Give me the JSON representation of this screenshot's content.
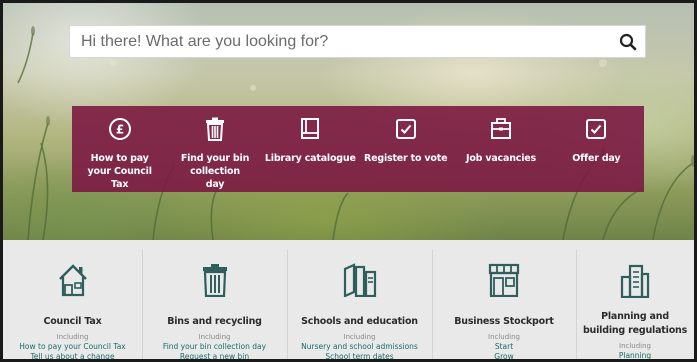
{
  "search": {
    "placeholder": "Hi there! What are you looking for?",
    "button_icon": "search-icon"
  },
  "quick_links": [
    {
      "label": "How to pay your Council Tax",
      "icon": "pound-coin-icon"
    },
    {
      "label": "Find your bin collection day",
      "icon": "bin-icon"
    },
    {
      "label": "Library catalogue",
      "icon": "book-icon"
    },
    {
      "label": "Register to vote",
      "icon": "checkbox-icon"
    },
    {
      "label": "Job vacancies",
      "icon": "briefcase-icon"
    },
    {
      "label": "Offer day",
      "icon": "checkbox-icon"
    }
  ],
  "services": [
    {
      "title": "Council Tax",
      "including": "Including",
      "links": [
        "How to pay your Council Tax",
        "Tell us about a change"
      ],
      "icon": "house-icon"
    },
    {
      "title": "Bins and recycling",
      "including": "Including",
      "links": [
        "Find your bin collection day",
        "Request a new bin"
      ],
      "icon": "bin-icon"
    },
    {
      "title": "Schools and education",
      "including": "Including",
      "links": [
        "Nursery and school admissions",
        "School term dates"
      ],
      "icon": "books-icon"
    },
    {
      "title": "Business Stockport",
      "including": "Including",
      "links": [
        "Start",
        "Grow"
      ],
      "icon": "shop-icon"
    },
    {
      "title": "Planning and building regulations",
      "including": "Including",
      "links": [
        "Planning"
      ],
      "icon": "buildings-icon"
    }
  ],
  "colors": {
    "quick_bg": "#7c1a42",
    "service_icon": "#2e5f5c",
    "link": "#1a6a6a"
  }
}
